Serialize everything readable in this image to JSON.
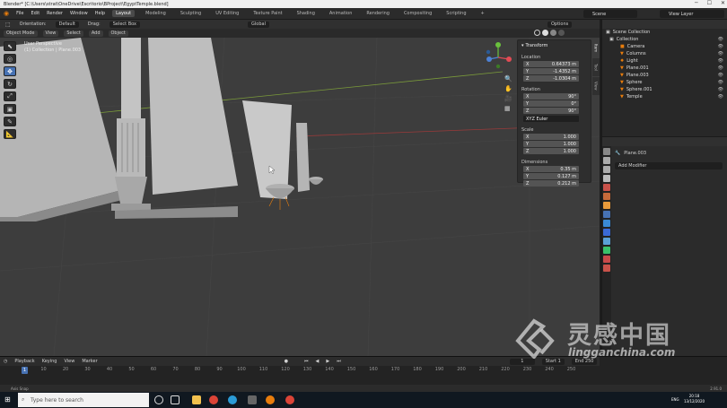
{
  "window": {
    "title": "Blender* [C:\\Users\\strat\\OneDrive\\Escritorio\\BProject\\EgyptTemple.blend]"
  },
  "menu": [
    "File",
    "Edit",
    "Render",
    "Window",
    "Help"
  ],
  "workspaces": [
    "Layout",
    "Modeling",
    "Sculpting",
    "UV Editing",
    "Texture Paint",
    "Shading",
    "Animation",
    "Rendering",
    "Compositing",
    "Scripting",
    "+"
  ],
  "scene": {
    "scene_label": "Scene",
    "view_layer_label": "View Layer"
  },
  "tool_header": {
    "orientation_label": "Orientation:",
    "orientation_value": "Default",
    "drag_label": "Drag:",
    "drag_value": "Select Box",
    "transform_value": "Global",
    "options_label": "Options"
  },
  "viewport_header": {
    "mode": "Object Mode",
    "menus": [
      "View",
      "Select",
      "Add",
      "Object"
    ]
  },
  "viewport_info": {
    "line1": "User Perspective",
    "line2": "(1) Collection | Plane.003"
  },
  "transform_panel": {
    "title": "Transform",
    "location_label": "Location",
    "location": [
      {
        "axis": "X",
        "value": "0.64373 m"
      },
      {
        "axis": "Y",
        "value": "-1.4352 m"
      },
      {
        "axis": "Z",
        "value": "-1.0304 m"
      }
    ],
    "rotation_label": "Rotation",
    "rotation": [
      {
        "axis": "X",
        "value": "90°"
      },
      {
        "axis": "Y",
        "value": "0°"
      },
      {
        "axis": "Z",
        "value": "90°"
      }
    ],
    "rotation_mode": "XYZ Euler",
    "scale_label": "Scale",
    "scale": [
      {
        "axis": "X",
        "value": "1.000"
      },
      {
        "axis": "Y",
        "value": "1.000"
      },
      {
        "axis": "Z",
        "value": "1.000"
      }
    ],
    "dimensions_label": "Dimensions",
    "dimensions": [
      {
        "axis": "X",
        "value": "0.35 m"
      },
      {
        "axis": "Y",
        "value": "0.127 m"
      },
      {
        "axis": "Z",
        "value": "0.212 m"
      }
    ]
  },
  "sidebar_tabs": [
    "Item",
    "Tool",
    "View"
  ],
  "outliner": {
    "root": "Scene Collection",
    "collection": "Collection",
    "items": [
      "Camera",
      "Columns",
      "Light",
      "Plane.001",
      "Plane.003",
      "Sphere",
      "Sphere.001",
      "Temple"
    ]
  },
  "properties": {
    "object_name": "Plane.003",
    "add_modifier": "Add Modifier"
  },
  "timeline": {
    "menus": [
      "Playback",
      "Keying",
      "View",
      "Marker"
    ],
    "current_frame": "1",
    "start_label": "Start",
    "start_value": "1",
    "end_label": "End",
    "end_value": "250",
    "ticks": [
      "10",
      "20",
      "30",
      "40",
      "50",
      "60",
      "70",
      "80",
      "90",
      "100",
      "110",
      "120",
      "130",
      "140",
      "150",
      "160",
      "170",
      "180",
      "190",
      "200",
      "210",
      "220",
      "230",
      "240",
      "250"
    ]
  },
  "status": {
    "left": "Axis Snap",
    "version": "2.91.0"
  },
  "taskbar": {
    "search_placeholder": "Type here to search",
    "lang": "ENG",
    "time": "20:18",
    "date": "13/12/2020"
  },
  "watermark": {
    "text": "灵感中国",
    "url": "lingganchina.com"
  },
  "colors": {
    "accent": "#4772b3",
    "viewport_bg": "#3d3d3d",
    "panel_bg": "#2b2b2b"
  }
}
